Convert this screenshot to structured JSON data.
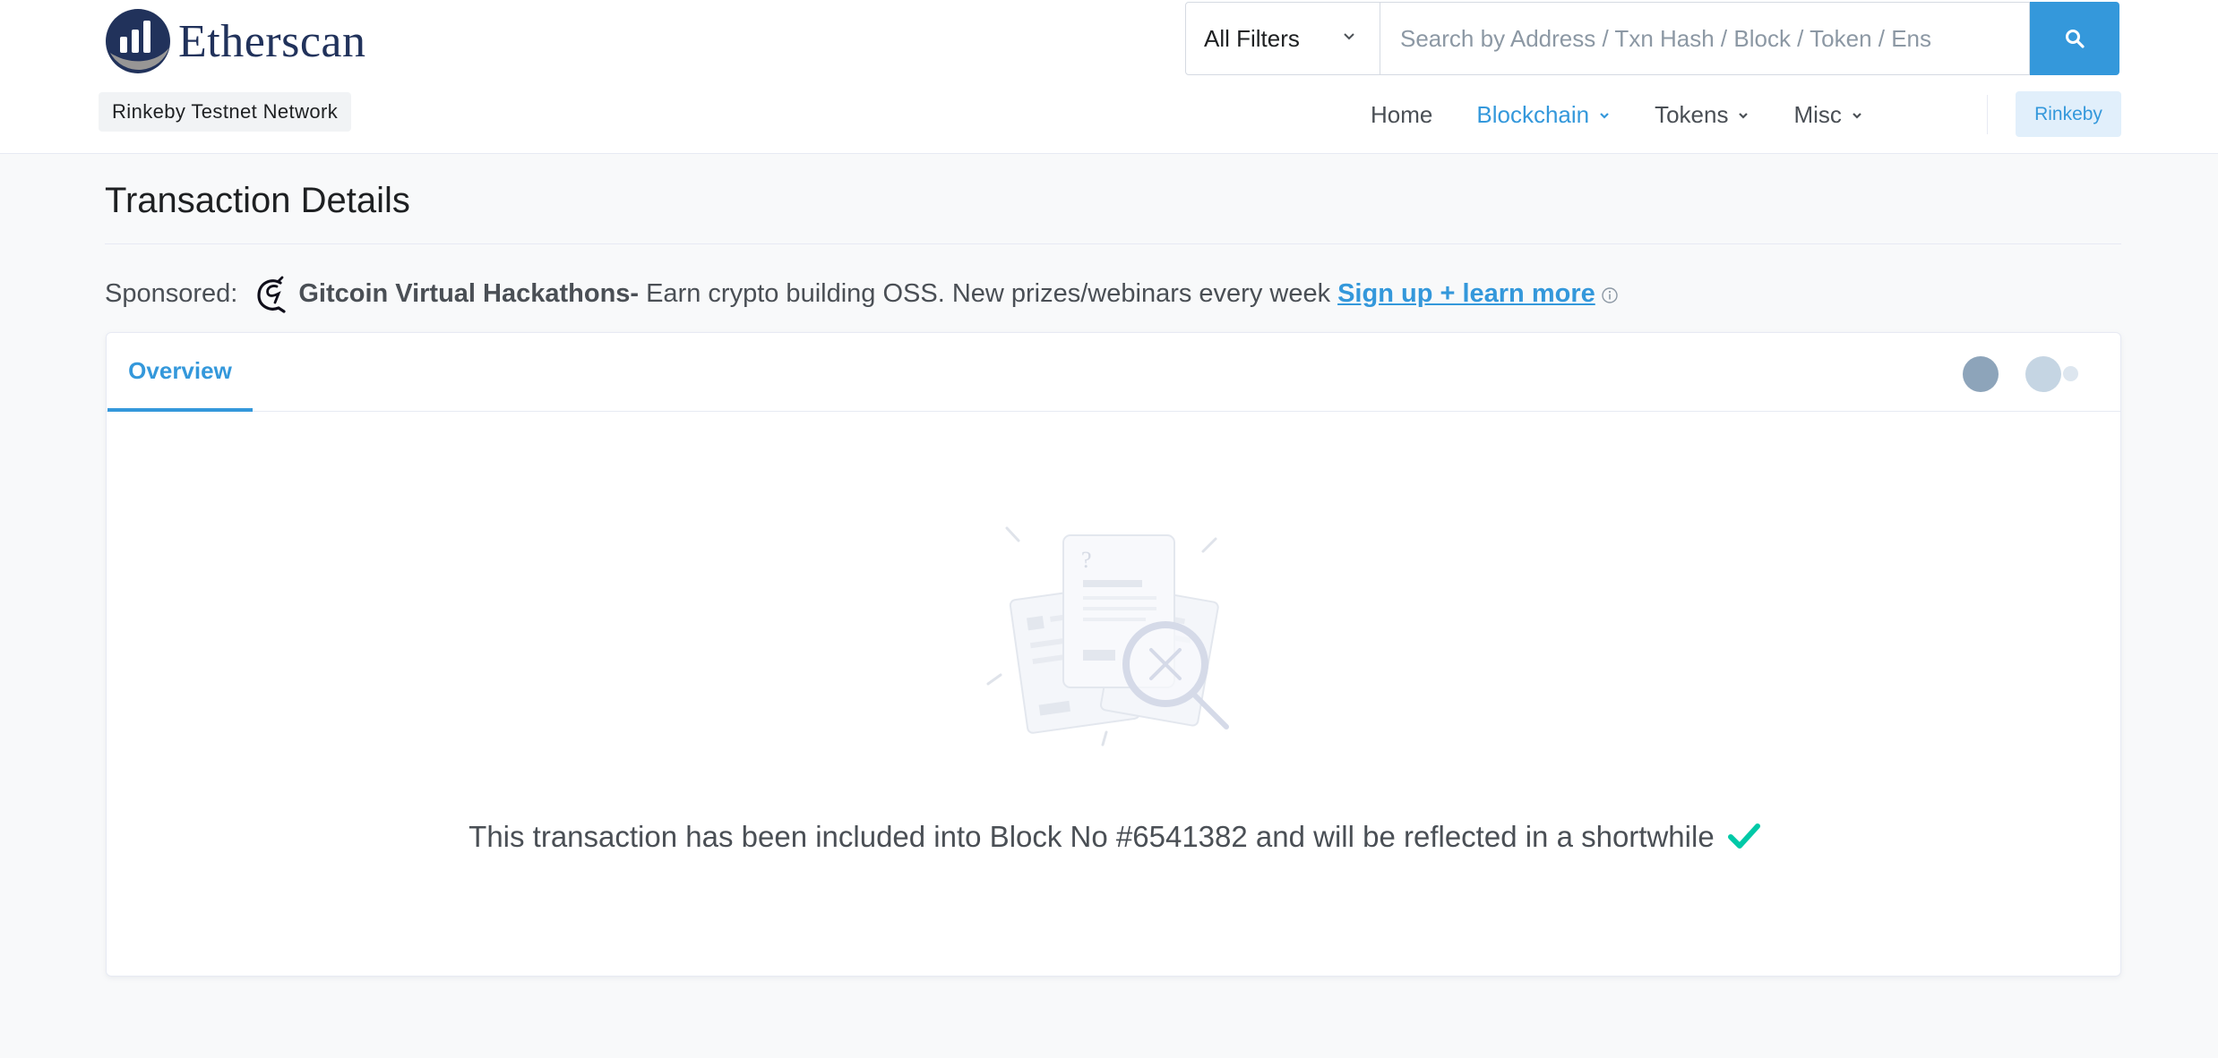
{
  "header": {
    "logo_text": "Etherscan",
    "network_badge": "Rinkeby Testnet Network",
    "filter_label": "All Filters",
    "search_placeholder": "Search by Address / Txn Hash / Block / Token / Ens",
    "nav": [
      {
        "label": "Home",
        "has_dropdown": false,
        "active": false
      },
      {
        "label": "Blockchain",
        "has_dropdown": true,
        "active": true
      },
      {
        "label": "Tokens",
        "has_dropdown": true,
        "active": false
      },
      {
        "label": "Misc",
        "has_dropdown": true,
        "active": false
      }
    ],
    "network_button": "Rinkeby"
  },
  "page": {
    "title": "Transaction Details"
  },
  "sponsor": {
    "label": "Sponsored:",
    "name": "Gitcoin Virtual Hackathons-",
    "text": "Earn crypto building OSS. New prizes/webinars every week",
    "link": "Sign up + learn more"
  },
  "card": {
    "tab_overview": "Overview",
    "status_message": "This transaction has been included into Block No #6541382 and will be reflected in a shortwhile"
  },
  "colors": {
    "accent": "#3498db",
    "brand_navy": "#21325b",
    "success": "#00c9a7"
  },
  "icons": [
    "etherscan-logo-icon",
    "chevron-down-icon",
    "search-icon",
    "gitcoin-icon",
    "info-icon",
    "empty-search-illustration",
    "check-icon"
  ]
}
